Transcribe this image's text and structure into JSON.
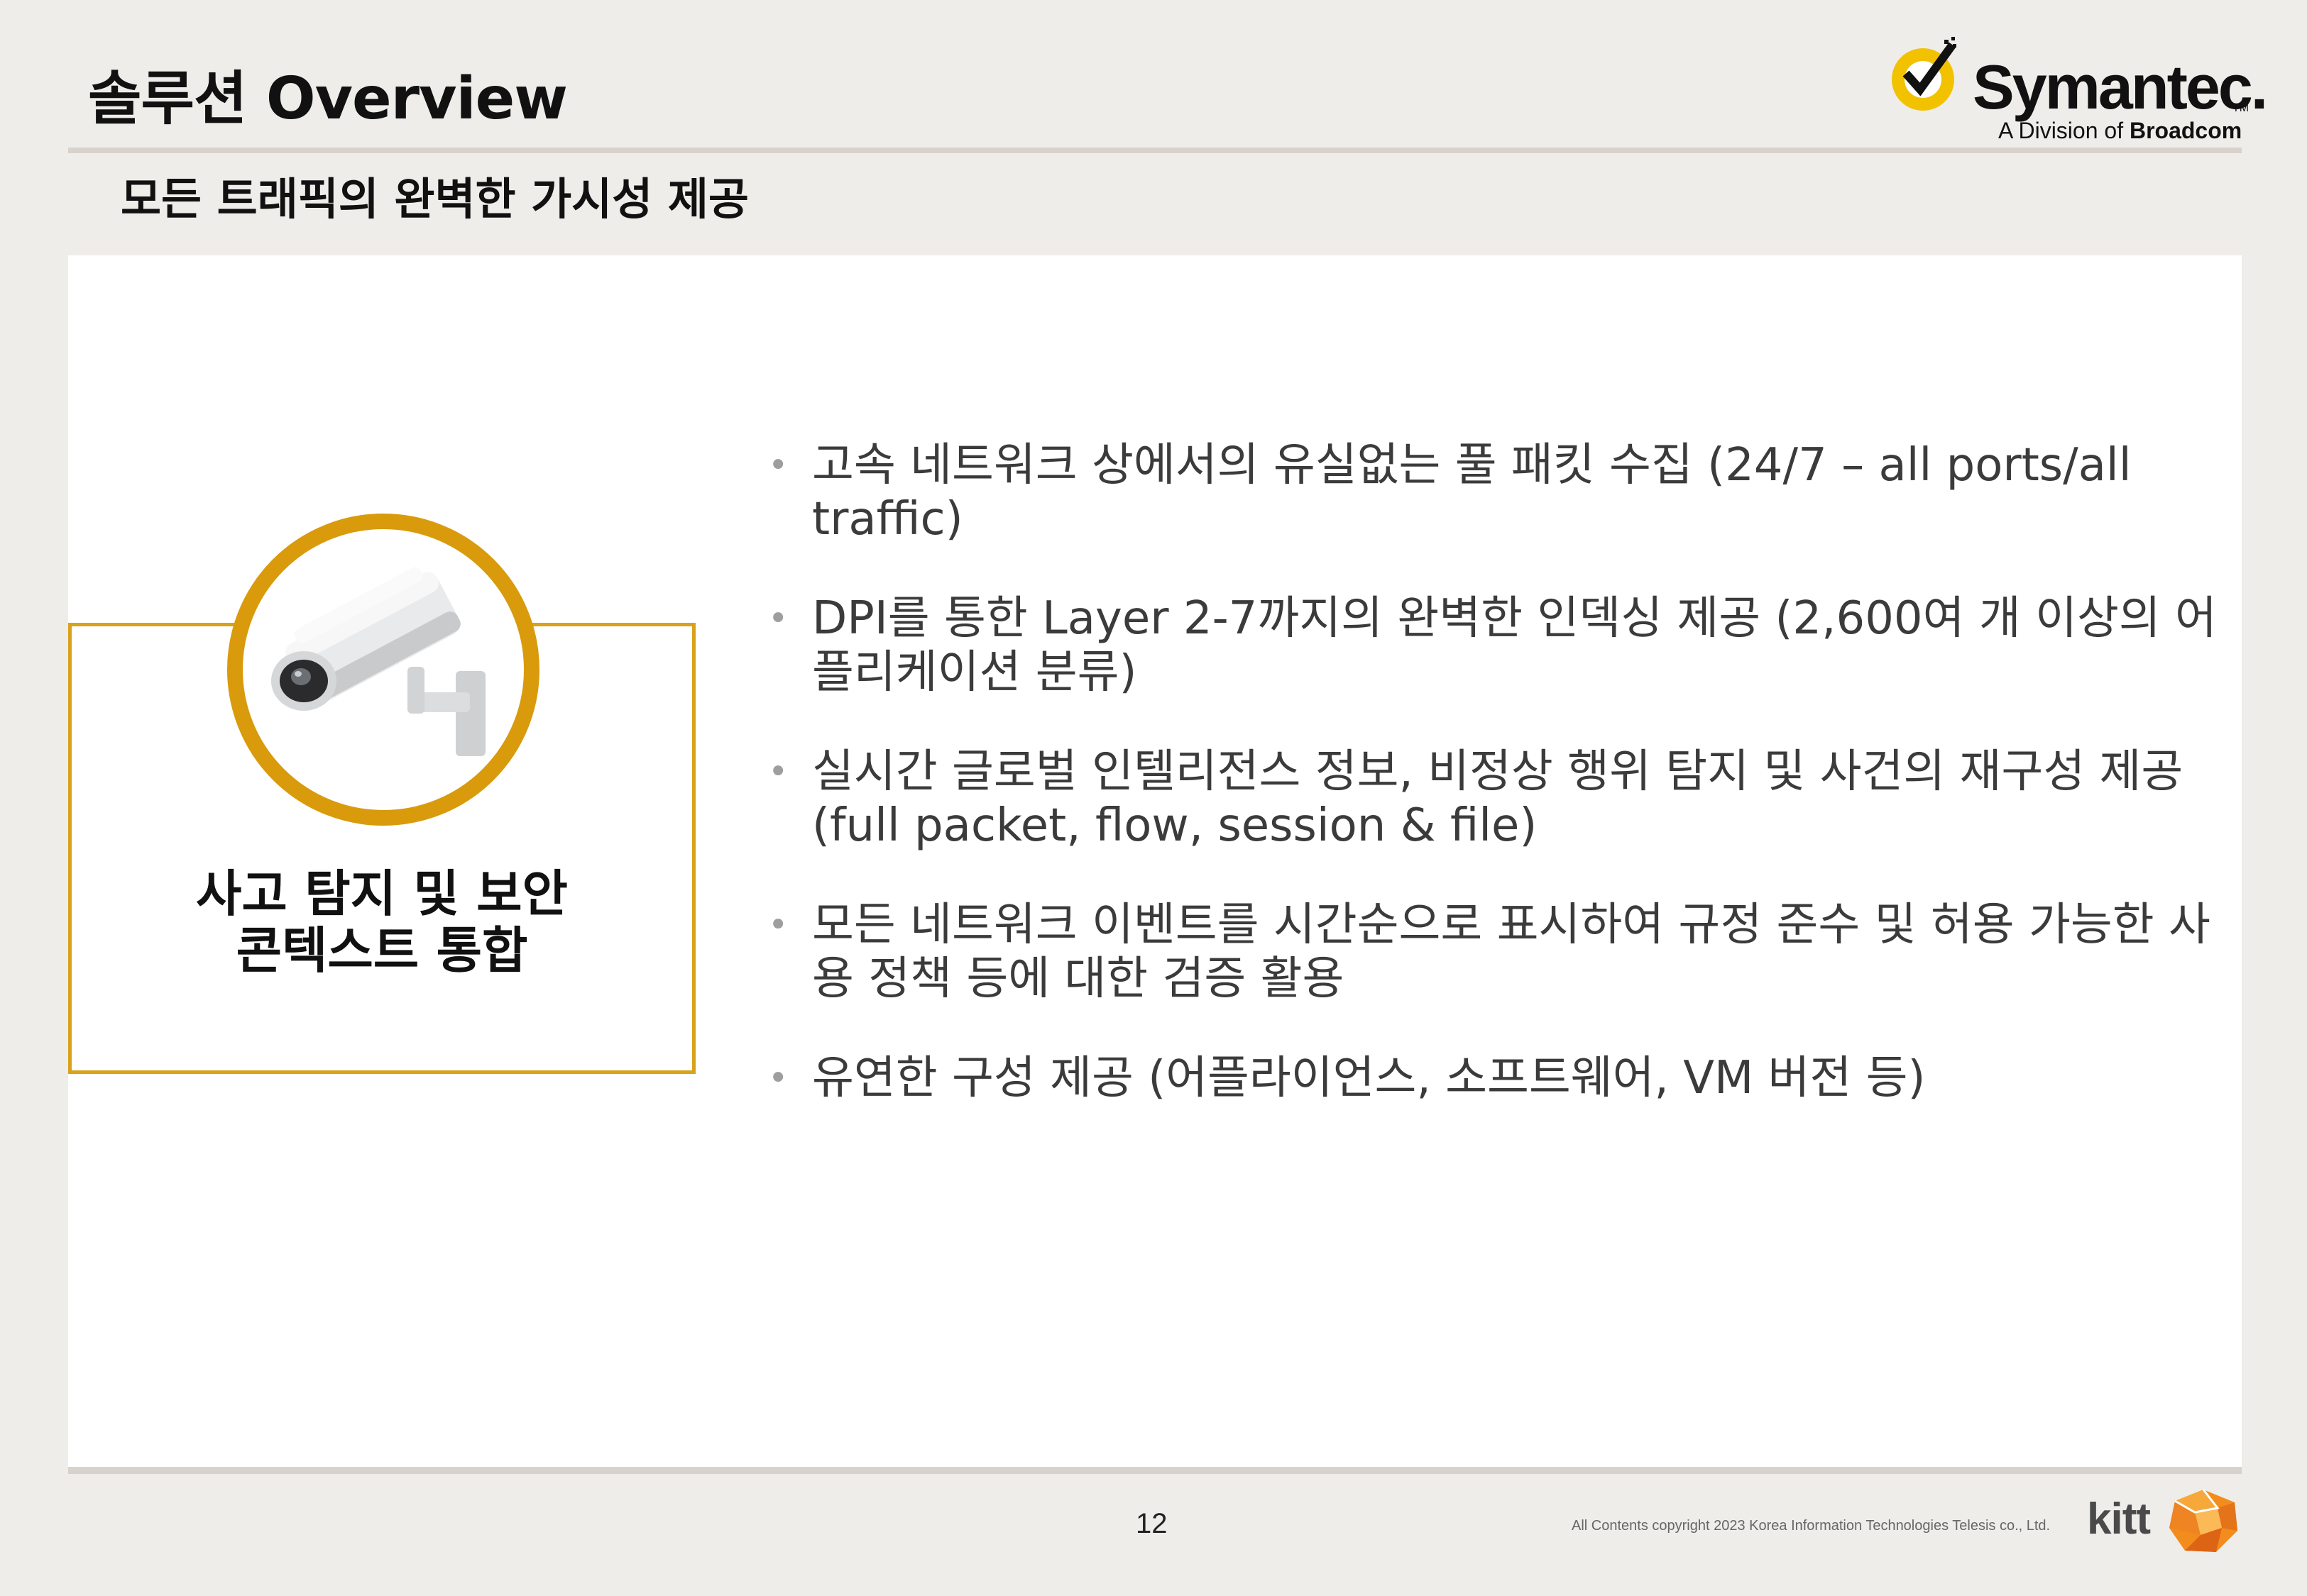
{
  "header": {
    "title": "솔루션 Overview",
    "subtitle": "모든 트래픽의 완벽한 가시성 제공"
  },
  "logo": {
    "brand": "Symantec.",
    "tm": "TM",
    "division_prefix": "A Division of",
    "division_company": "Broadcom",
    "icon": "symantec-check-logo"
  },
  "feature": {
    "label_line1": "사고 탐지 및 보안",
    "label_line2": "콘텍스트 통합",
    "icon": "security-camera-icon"
  },
  "bullets": [
    "고속 네트워크 상에서의 유실없는 풀 패킷 수집 (24/7 – all ports/all traffic)",
    "DPI를 통한 Layer 2-7까지의 완벽한 인덱싱 제공 (2,600여 개 이상의 어플리케이션 분류)",
    "실시간 글로벌 인텔리전스 정보, 비정상 행위 탐지 및 사건의 재구성 제공 (full packet, flow, session & file)",
    "모든 네트워크 이벤트를 시간순으로 표시하여 규정 준수 및 허용 가능한 사용 정책 등에 대한 검증 활용",
    "유연한 구성 제공 (어플라이언스, 소프트웨어, VM 버전 등)"
  ],
  "footer": {
    "page_number": "12",
    "copyright": "All Contents copyright 2023 Korea Information Technologies Telesis co., Ltd.",
    "kitt": "kitt"
  },
  "colors": {
    "accent_gold": "#d99a0c",
    "box_border": "#d9a21b",
    "background": "#efedea",
    "panel": "#ffffff",
    "bullet_text": "#3b3b3b"
  }
}
